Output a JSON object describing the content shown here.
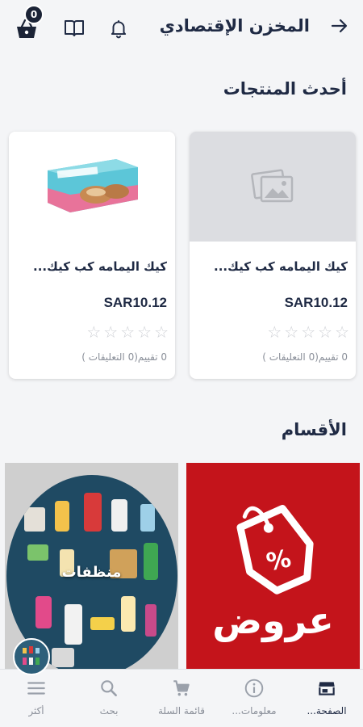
{
  "header": {
    "title": "المخزن الإقتصادي",
    "cart_count": "0"
  },
  "sections": {
    "latest": "أحدث المنتجات",
    "categories": "الأقسام"
  },
  "products": [
    {
      "name": "كيك اليمامه كب كيك...",
      "price": "SAR10.12",
      "rating": 0,
      "reviews": "0 تقييم(0 التعليقات )",
      "image": "placeholder-image-icon"
    },
    {
      "name": "كيك اليمامه كب كيك...",
      "price": "SAR10.12",
      "rating": 0,
      "reviews": "0 تقييم(0 التعليقات )",
      "image": "cake-box-photo"
    }
  ],
  "categories": [
    {
      "label": "عروض",
      "color": "#c4141b",
      "icon": "discount-tag-icon"
    },
    {
      "label": "منظفات",
      "color": "#1f4a63",
      "icon": "cleaning-products-photo"
    }
  ],
  "nav": [
    {
      "label": "الصفحة...",
      "icon": "store-icon",
      "active": true
    },
    {
      "label": "معلومات...",
      "icon": "info-icon",
      "active": false
    },
    {
      "label": "قائمة السلة",
      "icon": "cart-icon",
      "active": false
    },
    {
      "label": "بحث",
      "icon": "search-icon",
      "active": false
    },
    {
      "label": "أكثر",
      "icon": "menu-icon",
      "active": false
    }
  ],
  "colors": {
    "primary": "#1f2a44",
    "offers_red": "#c4141b",
    "star_empty": "#cfd1d6"
  }
}
